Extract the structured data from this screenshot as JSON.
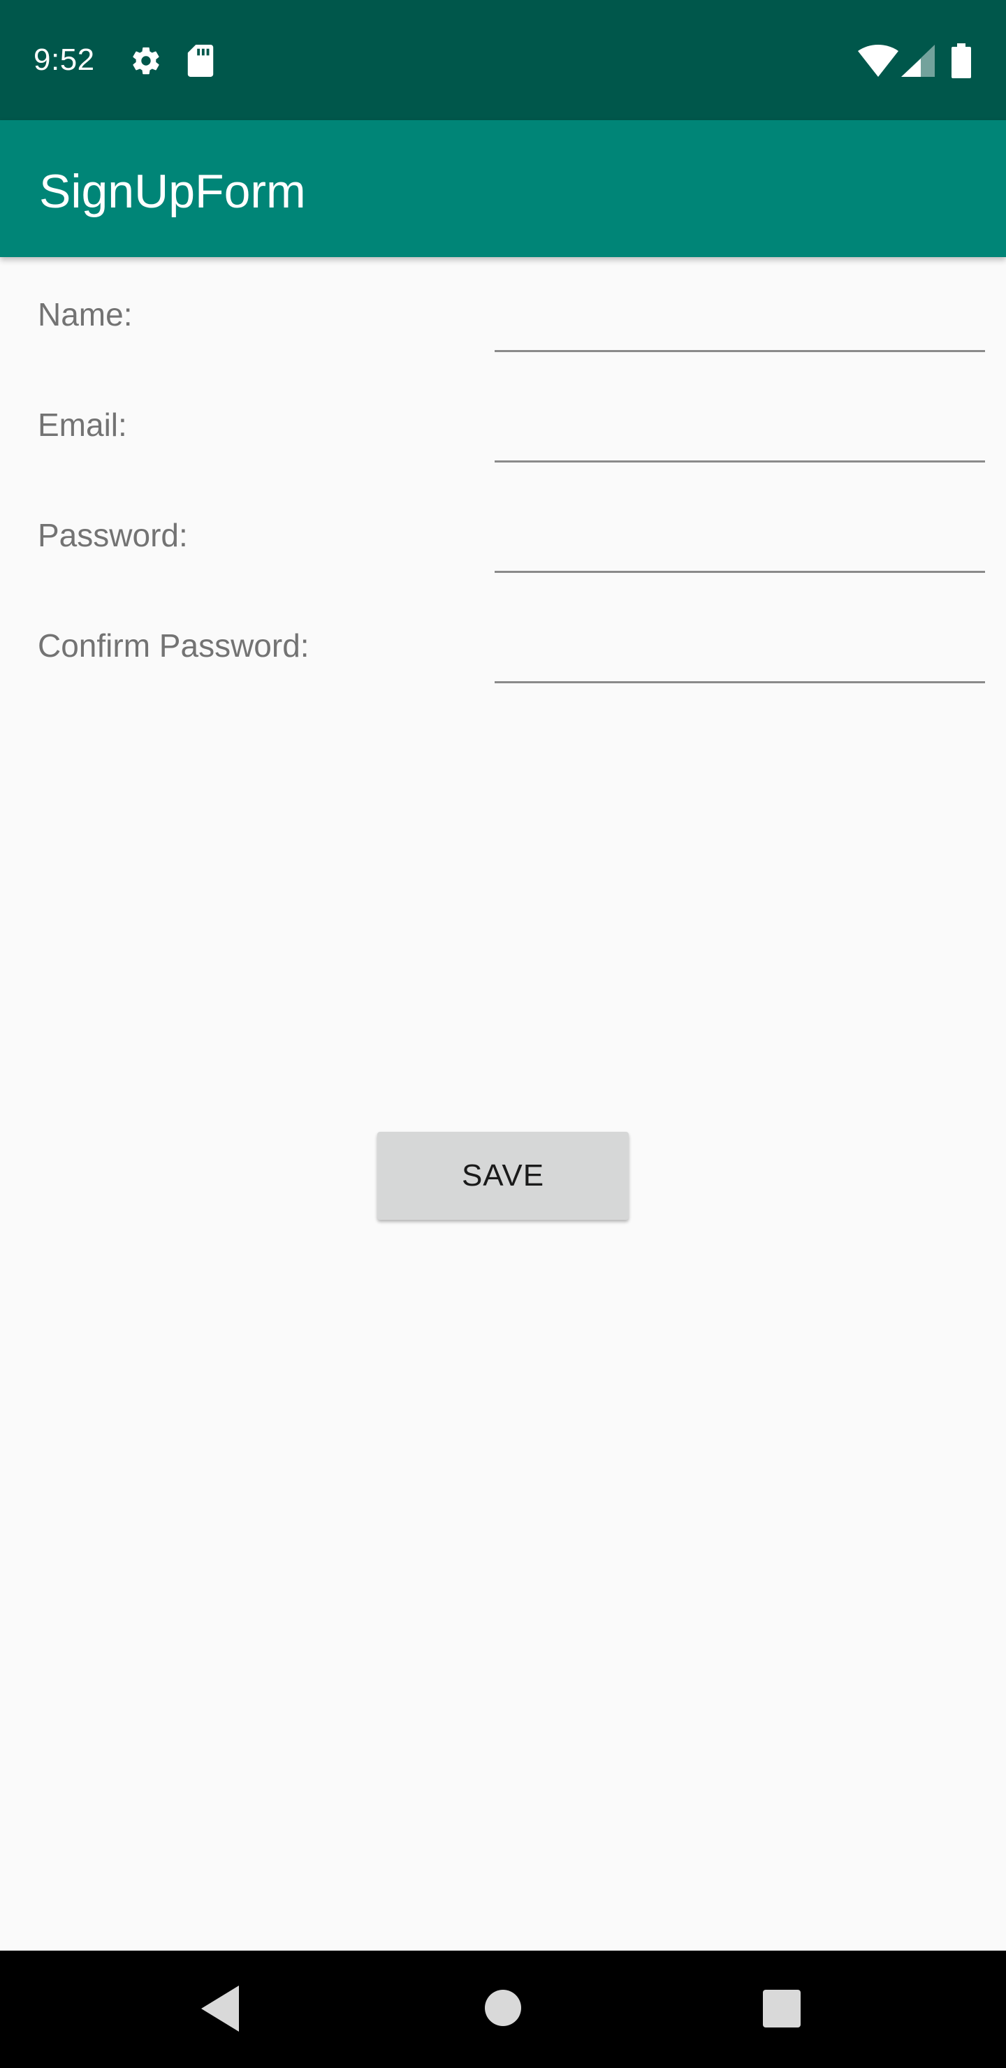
{
  "status_bar": {
    "time": "9:52",
    "icons": [
      "gear-icon",
      "sdcard-icon",
      "wifi-icon",
      "cell-signal-icon",
      "battery-icon"
    ],
    "background_color": "#00574b"
  },
  "app_bar": {
    "title": "SignUpForm",
    "background_color": "#008577"
  },
  "form": {
    "fields": [
      {
        "label": "Name:",
        "value": ""
      },
      {
        "label": "Email:",
        "value": ""
      },
      {
        "label": "Password:",
        "value": ""
      },
      {
        "label": "Confirm Password:",
        "value": ""
      }
    ]
  },
  "save_button": {
    "label": "SAVE"
  },
  "nav_bar": {
    "icons": [
      "back-icon",
      "home-icon",
      "recents-icon"
    ]
  }
}
